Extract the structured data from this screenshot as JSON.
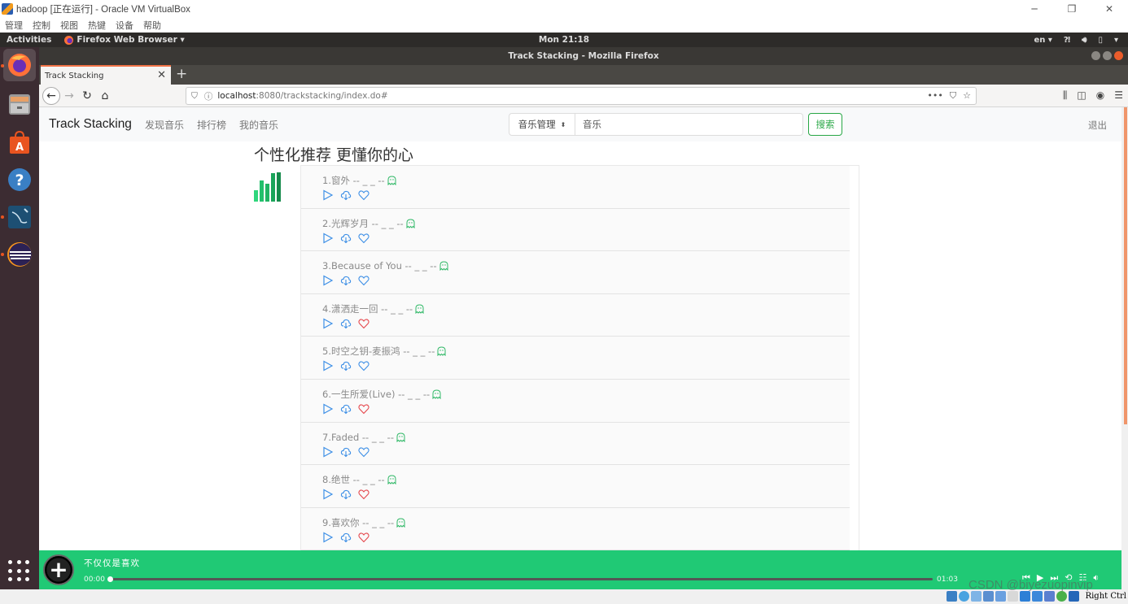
{
  "vbox": {
    "title": "hadoop [正在运行] - Oracle VM VirtualBox",
    "menu": [
      "管理",
      "控制",
      "视图",
      "热键",
      "设备",
      "帮助"
    ],
    "status_hint": "Right Ctrl"
  },
  "ubuntu": {
    "activities": "Activities",
    "app_menu": "Firefox Web Browser ▾",
    "clock": "Mon 21:18",
    "lang": "en ▾",
    "dock_items": [
      "firefox",
      "files",
      "software-center",
      "help",
      "mysql-workbench",
      "eclipse"
    ]
  },
  "firefox": {
    "window_title": "Track Stacking - Mozilla Firefox",
    "tab_title": "Track Stacking",
    "url_host": "localhost",
    "url_rest": ":8080/trackstacking/index.do#"
  },
  "site": {
    "brand": "Track Stacking",
    "nav": [
      "发现音乐",
      "排行榜",
      "我的音乐"
    ],
    "search": {
      "category": "音乐管理",
      "query": "音乐",
      "button": "搜索"
    },
    "logout": "退出",
    "section_title": "个性化推荐 更懂你的心",
    "songs": [
      {
        "title": "1.窗外 -- _ _ --",
        "liked": false
      },
      {
        "title": "2.光辉岁月 -- _ _ --",
        "liked": false
      },
      {
        "title": "3.Because of You -- _ _ --",
        "liked": false
      },
      {
        "title": "4.潇洒走一回 -- _ _ --",
        "liked": true
      },
      {
        "title": "5.时空之钥-麦振鸿 -- _ _ --",
        "liked": false
      },
      {
        "title": "6.一生所爱(Live) -- _ _ --",
        "liked": true
      },
      {
        "title": "7.Faded -- _ _ --",
        "liked": false
      },
      {
        "title": "8.绝世 -- _ _ --",
        "liked": true
      },
      {
        "title": "9.喜欢你 -- _ _ --",
        "liked": true
      }
    ],
    "colors": {
      "accent_green": "#20c975",
      "action_blue": "#3d8fe6",
      "liked_red": "#e5484d",
      "ghost_green": "#2fb866"
    }
  },
  "player": {
    "now_playing": "不仅仅是喜欢",
    "current_time": "00:00",
    "duration": "01:03",
    "progress": 0.0
  },
  "watermark": "CSDN @biyezuopinvip"
}
